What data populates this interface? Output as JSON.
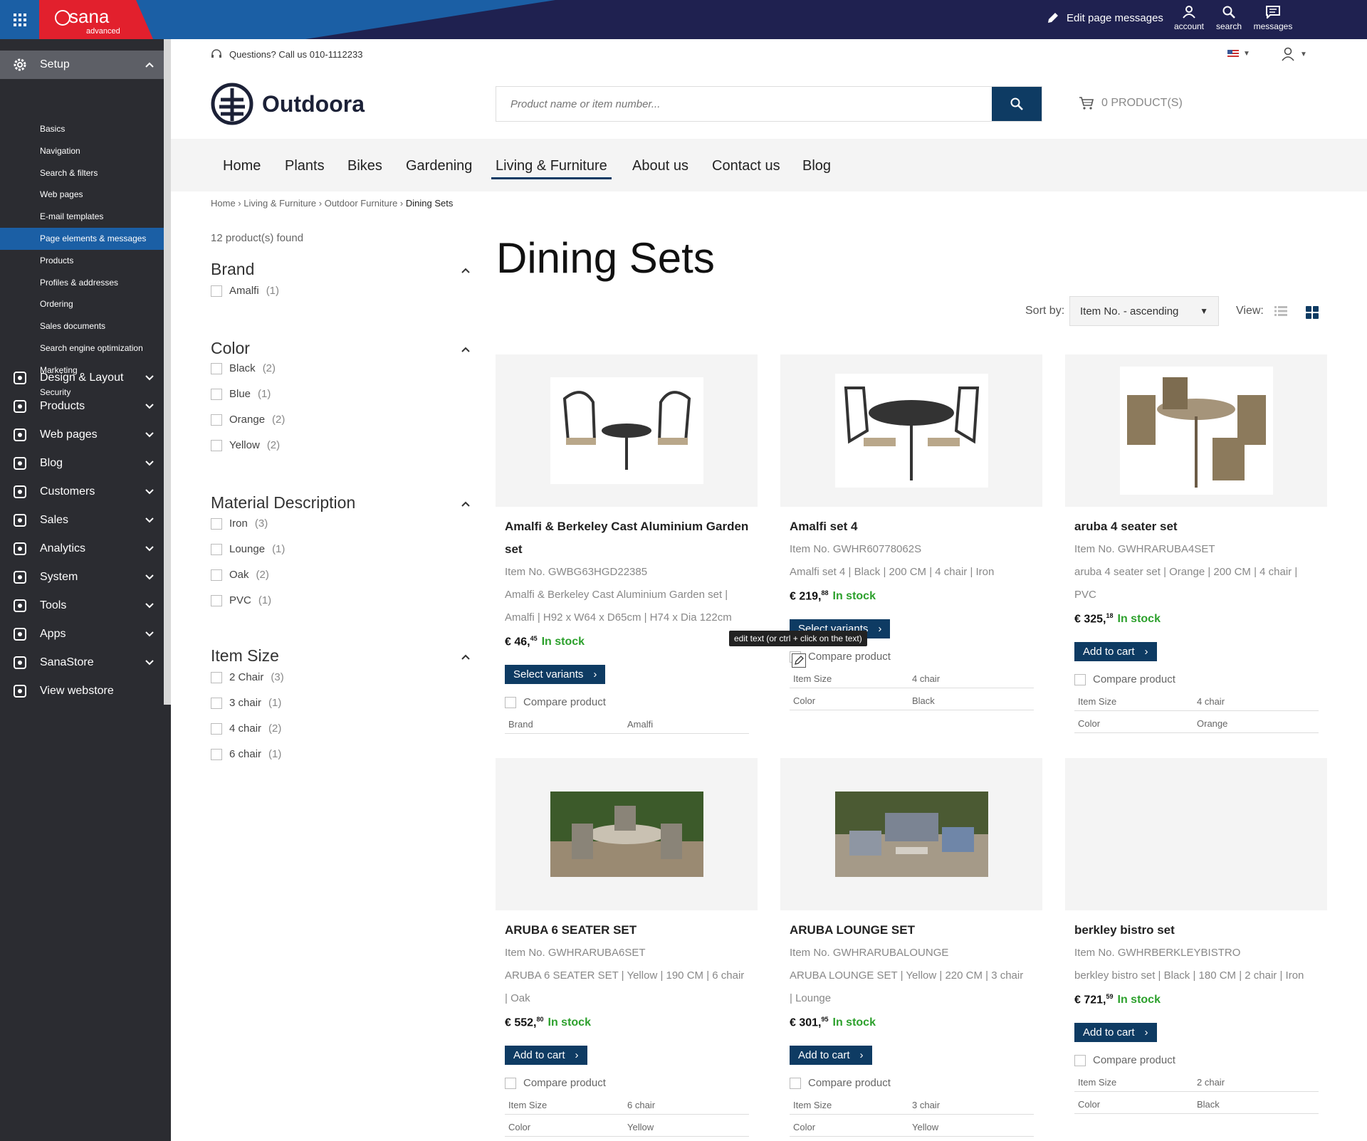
{
  "topbar": {
    "brand": "sana",
    "brand_sub": "advanced",
    "edit_messages": "Edit page messages",
    "account": "account",
    "search": "search",
    "messages": "messages"
  },
  "sidebar": {
    "setup": "Setup",
    "setup_items": [
      "Basics",
      "Navigation",
      "Search & filters",
      "Web pages",
      "E-mail templates",
      "Page elements & messages",
      "Products",
      "Profiles & addresses",
      "Ordering",
      "Sales documents",
      "Search engine optimization",
      "Marketing",
      "Security"
    ],
    "main_items": [
      "Design & Layout",
      "Products",
      "Web pages",
      "Blog",
      "Customers",
      "Sales",
      "Analytics",
      "System",
      "Tools",
      "Apps",
      "SanaStore",
      "View webstore"
    ]
  },
  "header": {
    "phone": "Questions? Call us 010-1112233",
    "logo": "Outdoora",
    "search_placeholder": "Product name or item number...",
    "cart": "0 PRODUCT(S)"
  },
  "nav": [
    "Home",
    "Plants",
    "Bikes",
    "Gardening",
    "Living & Furniture",
    "About us",
    "Contact us",
    "Blog"
  ],
  "breadcrumb": {
    "items": [
      "Home",
      "Living & Furniture",
      "Outdoor Furniture"
    ],
    "current": "Dining Sets"
  },
  "filters": {
    "found": "12 product(s) found",
    "brand": {
      "title": "Brand",
      "options": [
        {
          "label": "Amalfi",
          "count": "(1)"
        }
      ]
    },
    "color": {
      "title": "Color",
      "options": [
        {
          "label": "Black",
          "count": "(2)"
        },
        {
          "label": "Blue",
          "count": "(1)"
        },
        {
          "label": "Orange",
          "count": "(2)"
        },
        {
          "label": "Yellow",
          "count": "(2)"
        }
      ]
    },
    "material": {
      "title": "Material Description",
      "options": [
        {
          "label": "Iron",
          "count": "(3)"
        },
        {
          "label": "Lounge",
          "count": "(1)"
        },
        {
          "label": "Oak",
          "count": "(2)"
        },
        {
          "label": "PVC",
          "count": "(1)"
        }
      ]
    },
    "size": {
      "title": "Item Size",
      "options": [
        {
          "label": "2 Chair",
          "count": "(3)"
        },
        {
          "label": "3 chair",
          "count": "(1)"
        },
        {
          "label": "4 chair",
          "count": "(2)"
        },
        {
          "label": "6 chair",
          "count": "(1)"
        }
      ]
    }
  },
  "page": {
    "title": "Dining Sets",
    "sort_label": "Sort by:",
    "sort_value": "Item No. - ascending",
    "view_label": "View:"
  },
  "tooltip": "edit text (or ctrl + click on the text)",
  "products": [
    {
      "title_l1": "Amalfi & Berkeley Cast Aluminium Garden",
      "title_l2": "set",
      "item": "Item No. GWBG63HGD22385",
      "desc_l1": "Amalfi & Berkeley Cast Aluminium Garden set |",
      "desc_l2": "Amalfi | H92 x W64 x D65cm | H74 x Dia 122cm",
      "price": "€ 46,",
      "cents": "45",
      "stock": "In stock",
      "button": "Select variants",
      "compare": "Compare product",
      "specs": [
        [
          "Brand",
          "Amalfi"
        ]
      ]
    },
    {
      "title_l1": "Amalfi set 4",
      "item": "Item No. GWHR60778062S",
      "desc_l1": "Amalfi set 4 | Black | 200 CM | 4 chair | Iron",
      "price": "€ 219,",
      "cents": "88",
      "stock": "In stock",
      "button": "Select variants",
      "compare": "Compare product",
      "specs": [
        [
          "Item Size",
          "4 chair"
        ],
        [
          "Color",
          "Black"
        ]
      ]
    },
    {
      "title_l1": "aruba 4 seater set",
      "item": "Item No. GWHRARUBA4SET",
      "desc_l1": "aruba 4 seater set | Orange | 200 CM | 4 chair |",
      "desc_l2": "PVC",
      "price": "€ 325,",
      "cents": "18",
      "stock": "In stock",
      "button": "Add to cart",
      "compare": "Compare product",
      "specs": [
        [
          "Item Size",
          "4 chair"
        ],
        [
          "Color",
          "Orange"
        ]
      ]
    },
    {
      "title_l1": "ARUBA 6 SEATER SET",
      "item": "Item No. GWHRARUBA6SET",
      "desc_l1": "ARUBA 6 SEATER SET | Yellow | 190 CM | 6 chair",
      "desc_l2": "| Oak",
      "price": "€ 552,",
      "cents": "80",
      "stock": "In stock",
      "button": "Add to cart",
      "compare": "Compare product",
      "specs": [
        [
          "Item Size",
          "6 chair"
        ],
        [
          "Color",
          "Yellow"
        ]
      ]
    },
    {
      "title_l1": "ARUBA LOUNGE SET",
      "item": "Item No. GWHRARUBALOUNGE",
      "desc_l1": "ARUBA LOUNGE SET | Yellow | 220 CM | 3 chair",
      "desc_l2": "| Lounge",
      "price": "€ 301,",
      "cents": "95",
      "stock": "In stock",
      "button": "Add to cart",
      "compare": "Compare product",
      "specs": [
        [
          "Item Size",
          "3 chair"
        ],
        [
          "Color",
          "Yellow"
        ]
      ]
    },
    {
      "title_l1": "berkley bistro set",
      "item": "Item No. GWHRBERKLEYBISTRO",
      "desc_l1": "berkley bistro set | Black | 180 CM | 2 chair | Iron",
      "price": "€ 721,",
      "cents": "59",
      "stock": "In stock",
      "button": "Add to cart",
      "compare": "Compare product",
      "specs": [
        [
          "Item Size",
          "2 chair"
        ],
        [
          "Color",
          "Black"
        ]
      ]
    }
  ]
}
